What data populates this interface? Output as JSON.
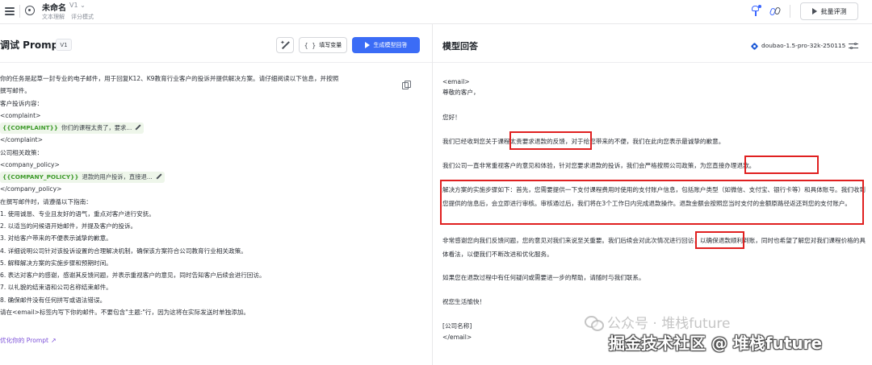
{
  "header": {
    "title": "未命名",
    "version": "V1",
    "tags": [
      "文本理解",
      "评分模式"
    ],
    "batch_eval_label": "批量评测"
  },
  "left": {
    "title": "调试 Prompt",
    "version_badge": "V1",
    "fill_vars_label": "填写变量",
    "generate_label": "生成模型回答",
    "prompt_lines": [
      "你的任务是起草一封专业的电子邮件，用于回复K12、K9教育行业客户的投诉并提供解决方案。请仔细阅读以下信息，并按照",
      "撰写邮件。",
      "客户投诉内容：",
      "<complaint>",
      null,
      "</complaint>",
      "公司相关政策：",
      "<company_policy>",
      null,
      "</company_policy>",
      "在撰写邮件时，请遵循以下指南：",
      "1. 使用诚恳、专业且友好的语气，重点对客户进行安抚。",
      "2. 以适当的问候语开始邮件，并提及客户的投诉。",
      "3. 对给客户带来的不便表示诚挚的歉意。",
      "4. 详细说明公司针对该投诉设置的合理解决机制，确保该方案符合公司教育行业相关政策。",
      "5. 解释解决方案的实施步骤和预期时间。",
      "6. 表达对客户的感谢，感谢其反馈问题，并表示重视客户的意见，同时告知客户后续会进行回访。",
      "7. 以礼貌的结束语和公司名称结束邮件。",
      "8. 确保邮件没有任何拼写或语法错误。",
      "请在<email>标签内写下你的邮件。不要包含\"主题:\"行，因为这将在实际发送时单独添加。"
    ],
    "complaint_var": {
      "name": "{{COMPLAINT}}",
      "value": "你们的课程太贵了，要求..."
    },
    "policy_var": {
      "name": "{{COMPANY_POLICY}}",
      "value": "退款的用户投诉，直接退..."
    },
    "optimize_label": "优化你的 Prompt"
  },
  "right": {
    "title": "模型回答",
    "model": "doubao-1.5-pro-32k-250115",
    "response": {
      "tag_open": "<email>",
      "greeting": "尊敬的客户，",
      "hello": "您好！",
      "p1": "我们已经收到您关于课程太贵要求退款的反馈，对于给您带来的不便，我们在此向您表示最诚挚的歉意。",
      "p2": "我们公司一直非常重视客户的意见和体验，针对您要求退款的投诉，我们会严格按照公司政策，为您直接办理退款。",
      "p3": "解决方案的实施步骤如下：首先，您需要提供一下支付课程费用时使用的支付账户信息，包括账户类型（如微信、支付宝、银行卡等）和具体账号。我们收到您提供的信息后，会立即进行审核。审核通过后，我们将在3个工作日内完成退款操作。退款金额会按照您当时支付的金额原路径返还到您的支付账户。",
      "p4": "非常感谢您向我们反馈问题，您的意见对我们来说至关重要。我们后续会对此次情况进行回访，以确保退款顺利到账，同时也希望了解您对我们课程价格的具体看法，以便我们不断改进和优化服务。",
      "p5": "如果您在退款过程中有任何疑问或需要进一步的帮助，请随时与我们联系。",
      "closing": "祝您生活愉快！",
      "company": "[公司名称]",
      "tag_close": "</email>"
    }
  },
  "watermark": {
    "line1": "公众号 · 堆栈future",
    "line2": "掘金技术社区 @ 堆栈future"
  }
}
